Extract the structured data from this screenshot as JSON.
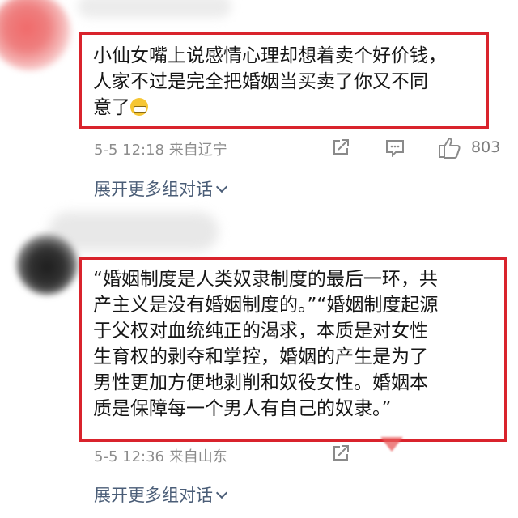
{
  "comment1": {
    "lines": [
      "小仙女嘴上说感情心理却想着卖个好价钱，",
      "人家不过是完全把婚姻当买卖了你又不同",
      "意了"
    ],
    "emoji_icon": "grinning-face-icon",
    "meta": "5-5 12:18  来自辽宁",
    "like_count": "803",
    "expand_label": "展开更多组对话"
  },
  "comment2": {
    "lines": [
      "“婚姻制度是人类奴隶制度的最后一环，共",
      "产主义是没有婚姻制度的。”“婚姻制度起源",
      "于父权对血统纯正的渴求，本质是对女性",
      "生育权的剥夺和掌控，婚姻的产生是为了",
      "男性更加方便地剥削和奴役女性。婚姻本",
      "质是保障每一个男人有自己的奴隶。”"
    ],
    "meta": "5-5 12:36  来自山东",
    "expand_label": "展开更多组对话"
  },
  "colors": {
    "highlight_border": "#d9232c",
    "link": "#4a5d77",
    "meta": "#8d8d8d"
  }
}
